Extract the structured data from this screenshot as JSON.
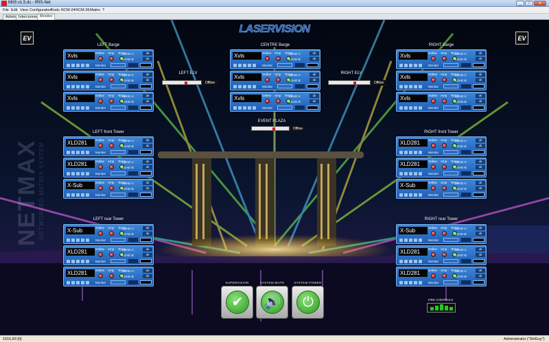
{
  "window": {
    "title": "MIIS v1.5.ds - IRIS-Net",
    "controls": [
      "_",
      "□",
      "x"
    ]
  },
  "menu": [
    "File",
    "Edit",
    "View",
    "Configuration",
    "Tools",
    "RCM-24",
    "RCM-26",
    "Matrix",
    "?"
  ],
  "tabs": [
    {
      "label": "Admin"
    },
    {
      "label": "Interconnect"
    },
    {
      "label": "Monitor"
    }
  ],
  "logo": "LASERVISION",
  "brand_mark": "EV",
  "watermark": {
    "line1": "NETMAX",
    "line2": "NETWORKED MATRIX SYSTEM"
  },
  "panel_labels": {
    "online": "Online",
    "amp": "Amp",
    "temp": "Temp",
    "load_a": "LOAD A:",
    "load_b": "LOAD B:",
    "ok": "ok",
    "monitor": "Monitor"
  },
  "groups": [
    {
      "title": "LEFT Barge",
      "panels": [
        {
          "device": "Xvls",
          "online": "red",
          "amp": "red",
          "temp": "green"
        },
        {
          "device": "Xvls",
          "online": "red",
          "amp": "red",
          "temp": "green"
        },
        {
          "device": "Xvls",
          "online": "red",
          "amp": "red",
          "temp": "green"
        }
      ]
    },
    {
      "title": "CENTRE Barge",
      "panels": [
        {
          "device": "Xvls",
          "online": "red",
          "amp": "red",
          "temp": "green"
        },
        {
          "device": "Xvls",
          "online": "red",
          "amp": "red",
          "temp": "green"
        },
        {
          "device": "Xvls",
          "online": "red",
          "amp": "red",
          "temp": "green"
        }
      ]
    },
    {
      "title": "RIGHT Barge",
      "panels": [
        {
          "device": "Xvls",
          "online": "red",
          "amp": "red",
          "temp": "green"
        },
        {
          "device": "Xvls",
          "online": "red",
          "amp": "red",
          "temp": "green"
        },
        {
          "device": "Xvls",
          "online": "red",
          "amp": "red",
          "temp": "green"
        }
      ]
    },
    {
      "title": "LEFT front Tower",
      "panels": [
        {
          "device": "XLD281",
          "online": "red",
          "amp": "red",
          "temp": "green"
        },
        {
          "device": "XLD281",
          "online": "red",
          "amp": "red",
          "temp": "green"
        },
        {
          "device": "X-Sub",
          "online": "red",
          "amp": "red",
          "temp": "green"
        }
      ]
    },
    {
      "title": "RIGHT front Tower",
      "panels": [
        {
          "device": "XLD281",
          "online": "red",
          "amp": "red",
          "temp": "green"
        },
        {
          "device": "XLD281",
          "online": "red",
          "amp": "red",
          "temp": "green"
        },
        {
          "device": "X-Sub",
          "online": "red",
          "amp": "red",
          "temp": "green"
        }
      ]
    },
    {
      "title": "LEFT rear Tower",
      "panels": [
        {
          "device": "X-Sub",
          "online": "red",
          "amp": "red",
          "temp": "green"
        },
        {
          "device": "XLD281",
          "online": "red",
          "amp": "red",
          "temp": "green"
        },
        {
          "device": "XLD281",
          "online": "red",
          "amp": "red",
          "temp": "green"
        }
      ]
    },
    {
      "title": "RIGHT rear Tower",
      "panels": [
        {
          "device": "X-Sub",
          "online": "red",
          "amp": "red",
          "temp": "green"
        },
        {
          "device": "XLD281",
          "online": "red",
          "amp": "red",
          "temp": "green"
        },
        {
          "device": "XLD281",
          "online": "red",
          "amp": "red",
          "temp": "green"
        }
      ]
    }
  ],
  "elv": [
    {
      "title": "LEFT ELV",
      "status": "Offline"
    },
    {
      "title": "RIGHT ELV",
      "status": "Offline"
    },
    {
      "title": "EVENT PLAZA",
      "status": "Offline"
    }
  ],
  "controls": [
    {
      "label": "SUPERVISION",
      "icon": "check-icon"
    },
    {
      "label": "SYSTEM MUTE",
      "icon": "speaker-icon"
    },
    {
      "label": "SYSTEM POWER",
      "icon": "power-icon"
    }
  ],
  "fire_label": "FIRE CONTROLS",
  "status": {
    "coords": "1516,83 [0]",
    "user": "Administrator (\"ShiGuy\")"
  },
  "colors": {
    "panel": "#2a6fc9",
    "led_red": "#d00000",
    "led_green": "#19b319"
  }
}
